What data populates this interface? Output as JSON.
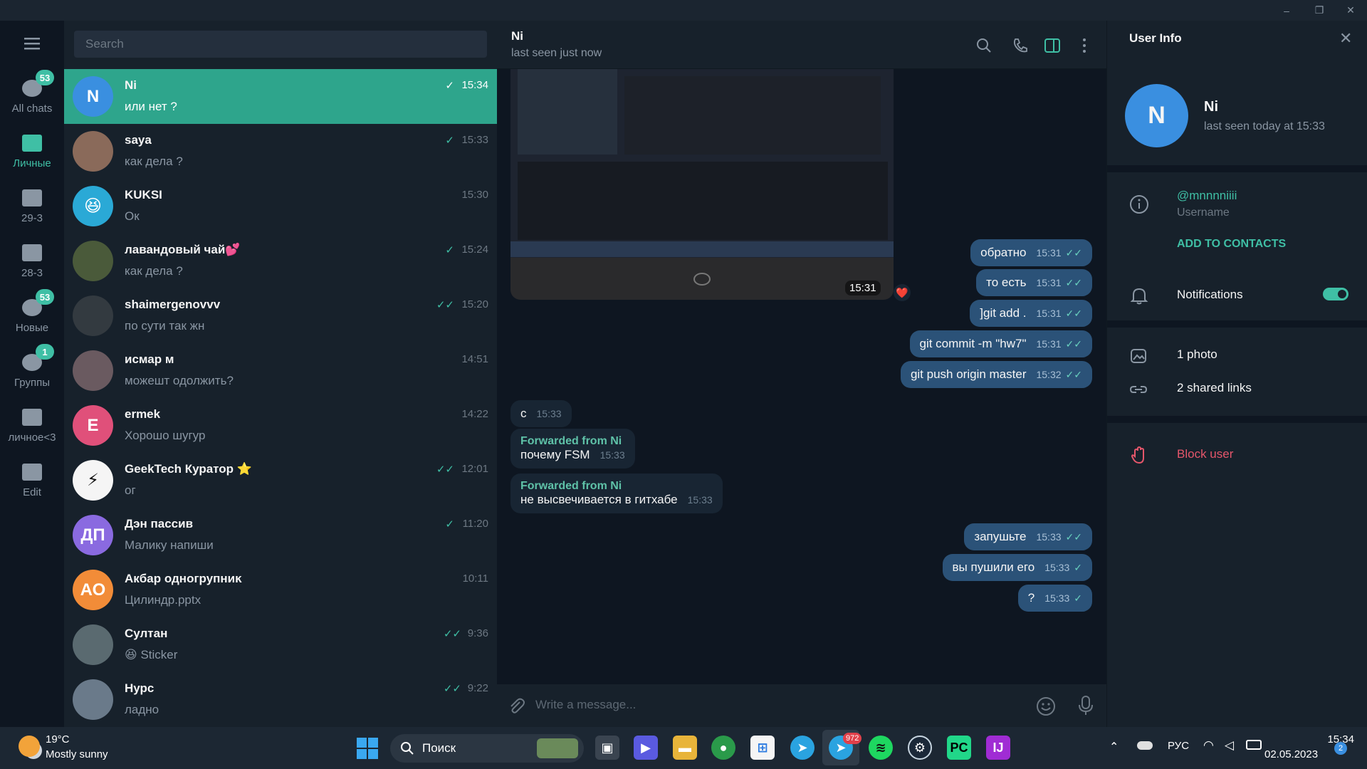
{
  "window": {
    "minimize": "–",
    "maximize": "❐",
    "close": "✕"
  },
  "rail": {
    "items": [
      {
        "label": "All chats",
        "badge": "53"
      },
      {
        "label": "Личные",
        "badge": ""
      },
      {
        "label": "29-3",
        "badge": ""
      },
      {
        "label": "28-3",
        "badge": ""
      },
      {
        "label": "Новые",
        "badge": "53"
      },
      {
        "label": "Группы",
        "badge": "1"
      },
      {
        "label": "личное<3",
        "badge": ""
      },
      {
        "label": "Edit",
        "badge": ""
      }
    ]
  },
  "search": {
    "placeholder": "Search"
  },
  "chats": [
    {
      "name": "Ni",
      "preview": "или нет ?",
      "time": "15:34",
      "check": "✓",
      "initials": "N",
      "color": "#3a8fe0"
    },
    {
      "name": "saya",
      "preview": "как дела ?",
      "time": "15:33",
      "check": "✓",
      "initials": "",
      "color": "#8a6a5a"
    },
    {
      "name": "KUKSI",
      "preview": "Ок",
      "time": "15:30",
      "check": "",
      "initials": "😆",
      "color": "#2aa9d6"
    },
    {
      "name": "лавандовый чай💕",
      "preview": "как дела ?",
      "time": "15:24",
      "check": "✓",
      "initials": "",
      "color": "#4a5a3a"
    },
    {
      "name": "shaimergenovvv",
      "preview": "по сути так жн",
      "time": "15:20",
      "check": "✓✓",
      "initials": "",
      "color": "#333a40"
    },
    {
      "name": "исмар м",
      "preview": "можешт одолжить?",
      "time": "14:51",
      "check": "",
      "initials": "",
      "color": "#6a5a60"
    },
    {
      "name": "ermek",
      "preview": "Хорошо шугур",
      "time": "14:22",
      "check": "",
      "initials": "E",
      "color": "#e0507a"
    },
    {
      "name": "GeekTech Куратор ⭐",
      "preview": "ог",
      "time": "12:01",
      "check": "✓✓",
      "initials": "⚡",
      "color": "#f5f5f5"
    },
    {
      "name": "Дэн пассив",
      "preview": "Малику напиши",
      "time": "11:20",
      "check": "✓",
      "initials": "ДП",
      "color": "#8a6ae0"
    },
    {
      "name": "Акбар одногрупниĸ",
      "preview": "Цилиндр.pptx",
      "time": "10:11",
      "check": "",
      "initials": "АО",
      "color": "#f28c38"
    },
    {
      "name": "Султан",
      "preview": "😆 Sticker",
      "time": "9:36",
      "check": "✓✓",
      "initials": "",
      "color": "#5a6a70"
    },
    {
      "name": "Нурс",
      "preview": "ладно",
      "time": "9:22",
      "check": "✓✓",
      "initials": "",
      "color": "#6a7a8a"
    }
  ],
  "chat": {
    "title": "Ni",
    "status": "last seen just now",
    "photo_time": "15:31",
    "photo_reaction": "❤️",
    "messages": [
      {
        "dir": "out",
        "text": "обратно",
        "time": "15:31",
        "check": "✓✓"
      },
      {
        "dir": "out",
        "text": "то есть",
        "time": "15:31",
        "check": "✓✓"
      },
      {
        "dir": "out",
        "text": "]git add .",
        "time": "15:31",
        "check": "✓✓"
      },
      {
        "dir": "out",
        "text": "git commit -m \"hw7\"",
        "time": "15:31",
        "check": "✓✓"
      },
      {
        "dir": "out",
        "text": "git push origin master",
        "time": "15:32",
        "check": "✓✓"
      },
      {
        "dir": "in",
        "text": "с",
        "time": "15:33",
        "fwd": ""
      },
      {
        "dir": "in",
        "text": "почему FSM",
        "time": "15:33",
        "fwd": "Forwarded from Ni"
      },
      {
        "dir": "in",
        "text": "не высвечивается в гитхабе",
        "time": "15:33",
        "fwd": "Forwarded from Ni"
      },
      {
        "dir": "out",
        "text": "запушьте",
        "time": "15:33",
        "check": "✓✓"
      },
      {
        "dir": "out",
        "text": "вы пушили его",
        "time": "15:33",
        "check": "✓"
      },
      {
        "dir": "out",
        "text": "?",
        "time": "15:33",
        "check": "✓"
      }
    ],
    "composer_placeholder": "Write a message..."
  },
  "info": {
    "header": "User Info",
    "name": "Ni",
    "initial": "N",
    "last_seen": "last seen today at 15:33",
    "username": "@mnnnniiii",
    "username_label": "Username",
    "add_contacts": "ADD TO CONTACTS",
    "notifications": "Notifications",
    "notifications_on": true,
    "photos": "1 photo",
    "links": "2 shared links",
    "block": "Block user"
  },
  "taskbar": {
    "weather_temp": "19°C",
    "weather_desc": "Mostly sunny",
    "search_label": "Поиск",
    "telegram_badge": "972",
    "lang": "РУС",
    "time": "15:34",
    "date": "02.05.2023",
    "notif_count": "2"
  }
}
